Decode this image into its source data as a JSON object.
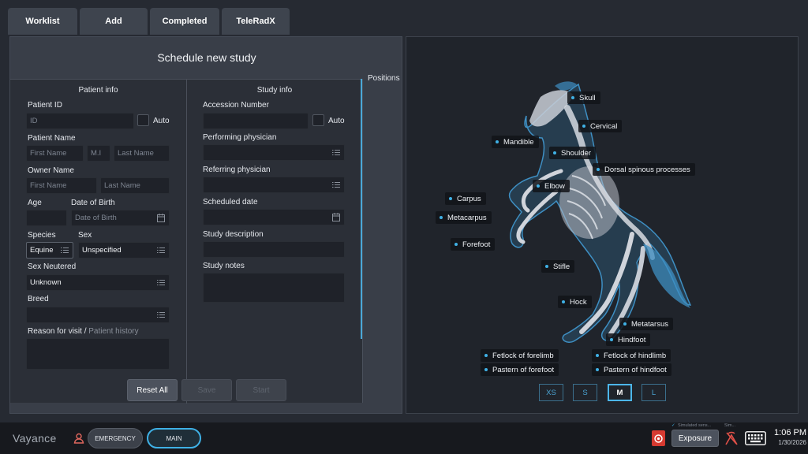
{
  "tabs": [
    {
      "label": "Worklist"
    },
    {
      "label": "Add"
    },
    {
      "label": "Completed"
    },
    {
      "label": "TeleRadX"
    }
  ],
  "form": {
    "title": "Schedule new study",
    "patient_info": {
      "heading": "Patient info",
      "patient_id_label": "Patient ID",
      "patient_id_placeholder": "ID",
      "auto_label": "Auto",
      "patient_name_label": "Patient Name",
      "first_name_placeholder": "First Name",
      "mi_placeholder": "M.I",
      "last_name_placeholder": "Last Name",
      "owner_name_label": "Owner Name",
      "owner_first_placeholder": "First Name",
      "owner_last_placeholder": "Last Name",
      "age_label": "Age",
      "dob_label": "Date of Birth",
      "dob_placeholder": "Date of Birth",
      "species_label": "Species",
      "species_value": "Equine",
      "sex_label": "Sex",
      "sex_value": "Unspecified",
      "sex_neutered_label": "Sex Neutered",
      "sex_neutered_value": "Unknown",
      "breed_label": "Breed",
      "reason_label": "Reason for visit / ",
      "patient_history_link": "Patient history"
    },
    "study_info": {
      "heading": "Study info",
      "accession_label": "Accession Number",
      "auto_label": "Auto",
      "performing_label": "Performing physician",
      "referring_label": "Referring physician",
      "scheduled_label": "Scheduled date",
      "description_label": "Study description",
      "notes_label": "Study notes"
    },
    "positions_label": "Positions",
    "buttons": {
      "reset": "Reset All",
      "save": "Save",
      "start": "Start"
    }
  },
  "anatomy": {
    "labels": {
      "skull": "Skull",
      "cervical": "Cervical",
      "mandible": "Mandible",
      "shoulder": "Shoulder",
      "dorsal": "Dorsal spinous processes",
      "elbow": "Elbow",
      "carpus": "Carpus",
      "metacarpus": "Metacarpus",
      "forefoot": "Forefoot",
      "stifle": "Stifle",
      "hock": "Hock",
      "metatarsus": "Metatarsus",
      "hindfoot": "Hindfoot",
      "fetlock_fore": "Fetlock of forelimb",
      "fetlock_hind": "Fetlock of hindlimb",
      "pastern_fore": "Pastern of forefoot",
      "pastern_hind": "Pastern of hindfoot"
    },
    "sizes": [
      "XS",
      "S",
      "M",
      "L"
    ],
    "selected_size": "M"
  },
  "bottombar": {
    "brand": "Vayance",
    "emergency": "EMERGENCY",
    "main": "MAIN",
    "exposure": "Exposure",
    "sim_status_1": "Simulated sens...",
    "sim_status_2": "Sim...",
    "time": "1:06 PM",
    "date": "1/30/2026"
  },
  "colors": {
    "accent": "#3fb1e6",
    "panel": "#393e48",
    "field": "#1f2229",
    "alert_red": "#d63a31"
  }
}
